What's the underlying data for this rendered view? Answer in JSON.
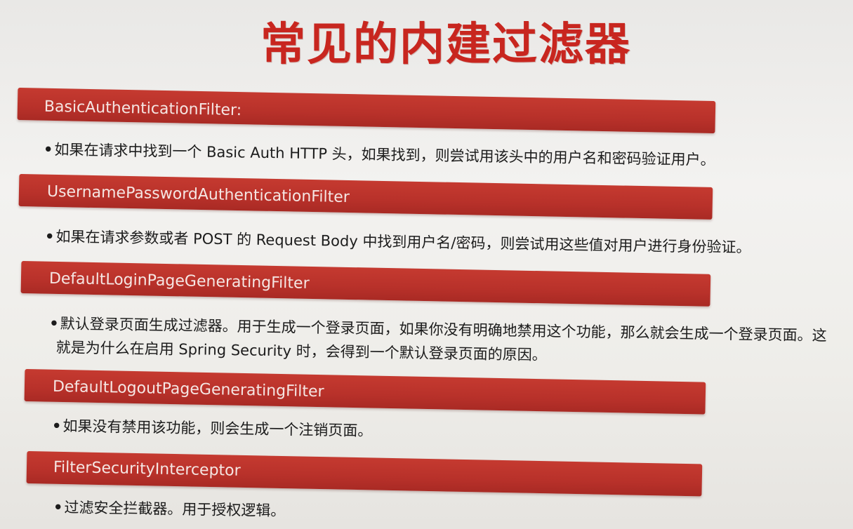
{
  "slide": {
    "title": "常见的内建过滤器",
    "colors": {
      "title": "#c8261f",
      "band": "#b8312a",
      "band_text": "#f5e6e3",
      "body_text": "#1c1c1c",
      "background": "#f1f0ee"
    },
    "filters": [
      {
        "name": "BasicAuthenticationFilter:",
        "bullet": "•",
        "description_lines": [
          "如果在请求中找到一个 Basic Auth HTTP 头，如果找到，则尝试用该头中的用户名和密码验证用户。"
        ]
      },
      {
        "name": "UsernamePasswordAuthenticationFilter",
        "bullet": "•",
        "description_lines": [
          "如果在请求参数或者 POST 的 Request Body 中找到用户名/密码，则尝试用这些值对用户进行身份验证。"
        ]
      },
      {
        "name": "DefaultLoginPageGeneratingFilter",
        "bullet": "•",
        "description_lines": [
          "默认登录页面生成过滤器。用于生成一个登录页面，如果你没有明确地禁用这个功能，那么就会生成一个登录页面。这",
          "就是为什么在启用 Spring Security 时，会得到一个默认登录页面的原因。"
        ]
      },
      {
        "name": "DefaultLogoutPageGeneratingFilter",
        "bullet": "•",
        "description_lines": [
          "如果没有禁用该功能，则会生成一个注销页面。"
        ]
      },
      {
        "name": "FilterSecurityInterceptor",
        "bullet": "•",
        "description_lines": [
          "过滤安全拦截器。用于授权逻辑。"
        ]
      }
    ]
  }
}
